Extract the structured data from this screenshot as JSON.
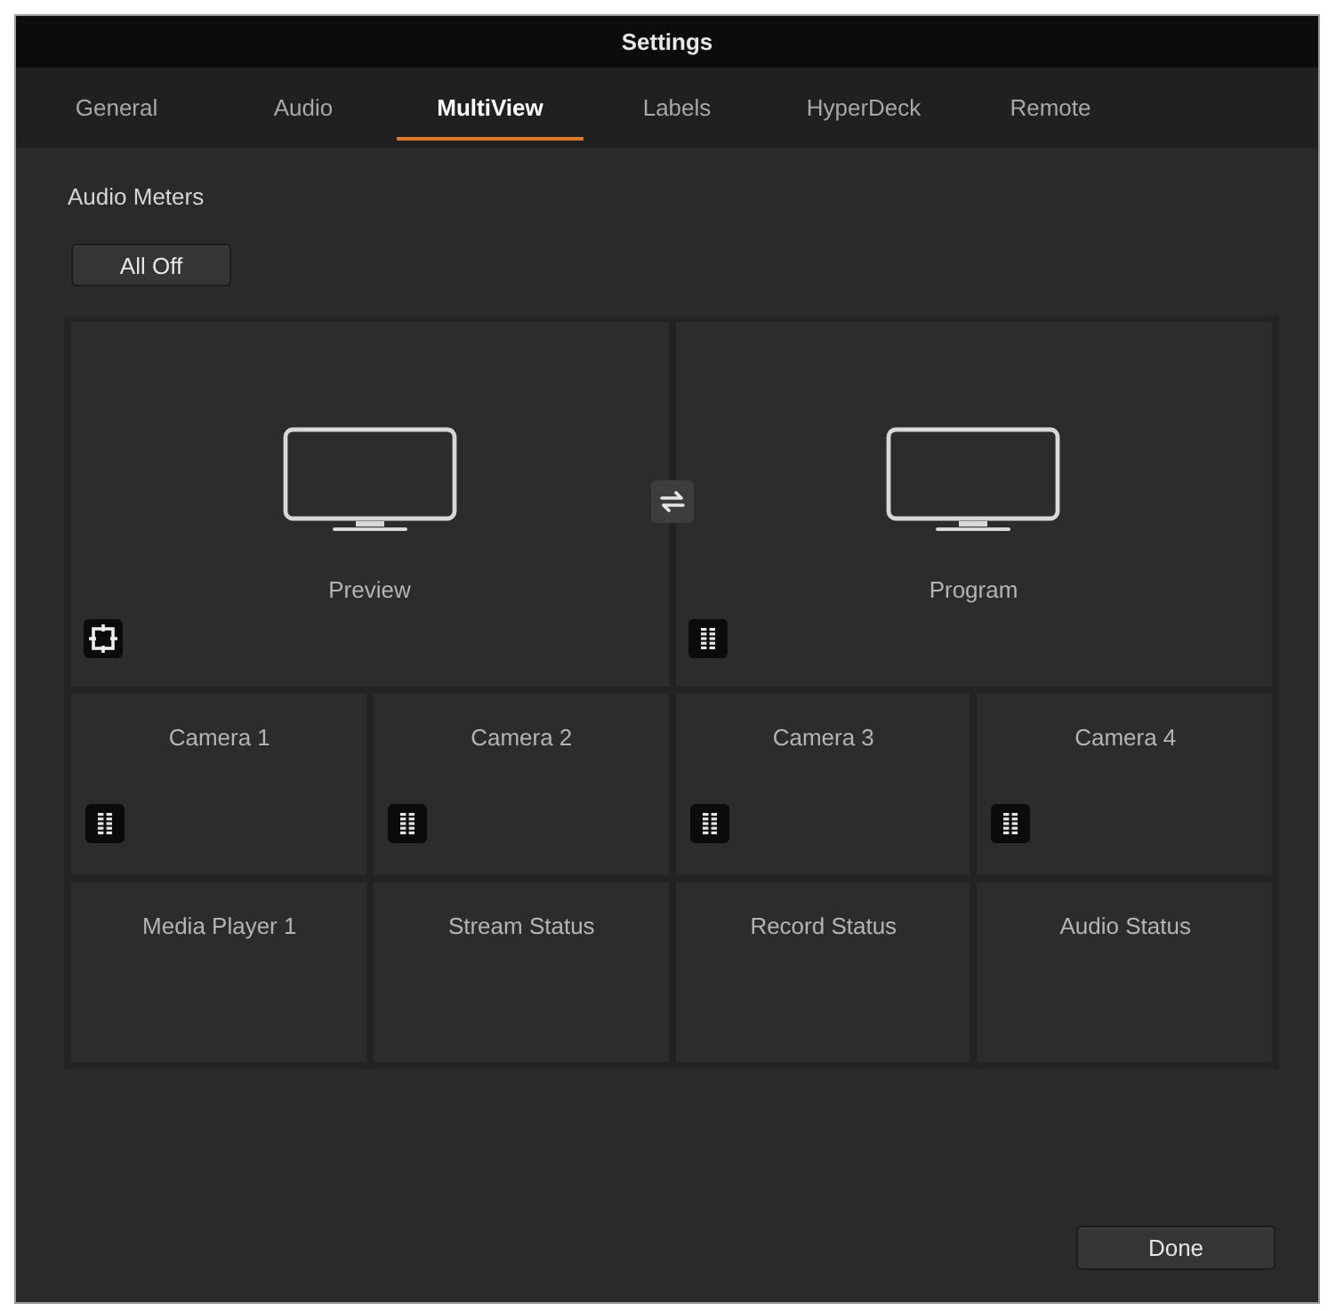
{
  "window": {
    "title": "Settings"
  },
  "tabs": [
    {
      "label": "General",
      "selected": false
    },
    {
      "label": "Audio",
      "selected": false
    },
    {
      "label": "MultiView",
      "selected": true
    },
    {
      "label": "Labels",
      "selected": false
    },
    {
      "label": "HyperDeck",
      "selected": false
    },
    {
      "label": "Remote",
      "selected": false
    }
  ],
  "audio_meters": {
    "heading": "Audio Meters",
    "button": "All Off"
  },
  "multiview": {
    "large_windows": [
      {
        "label": "Preview",
        "kind": "safearea"
      },
      {
        "label": "Program",
        "kind": "meter"
      }
    ],
    "small_windows": [
      {
        "label": "Camera 1",
        "kind": "meter"
      },
      {
        "label": "Camera 2",
        "kind": "meter"
      },
      {
        "label": "Camera 3",
        "kind": "meter"
      },
      {
        "label": "Camera 4",
        "kind": "meter"
      },
      {
        "label": "Media Player 1",
        "kind": "plain"
      },
      {
        "label": "Stream Status",
        "kind": "plain"
      },
      {
        "label": "Record Status",
        "kind": "plain"
      },
      {
        "label": "Audio Status",
        "kind": "plain"
      }
    ]
  },
  "buttons": [
    "Done"
  ]
}
